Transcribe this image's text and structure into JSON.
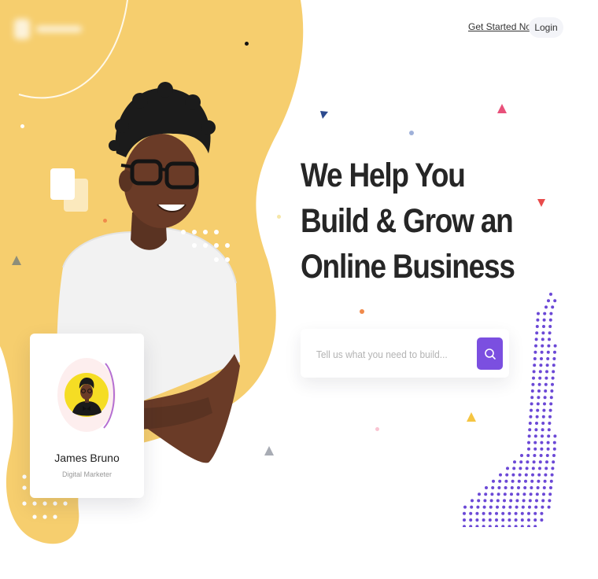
{
  "nav": {
    "get_started": "Get Started Now",
    "login": "Login"
  },
  "hero": {
    "headline_lines": [
      "We Help You",
      "Build & Grow an",
      "Online Business"
    ]
  },
  "search": {
    "placeholder": "Tell us what you need to build...",
    "value": ""
  },
  "profile_card": {
    "name": "James Bruno",
    "role": "Digital Marketer"
  },
  "colors": {
    "accent_purple": "#7b4fe0",
    "blob_yellow": "#f6ce6e",
    "headline": "#262626"
  },
  "icons": {
    "search": "magnifier-icon"
  }
}
